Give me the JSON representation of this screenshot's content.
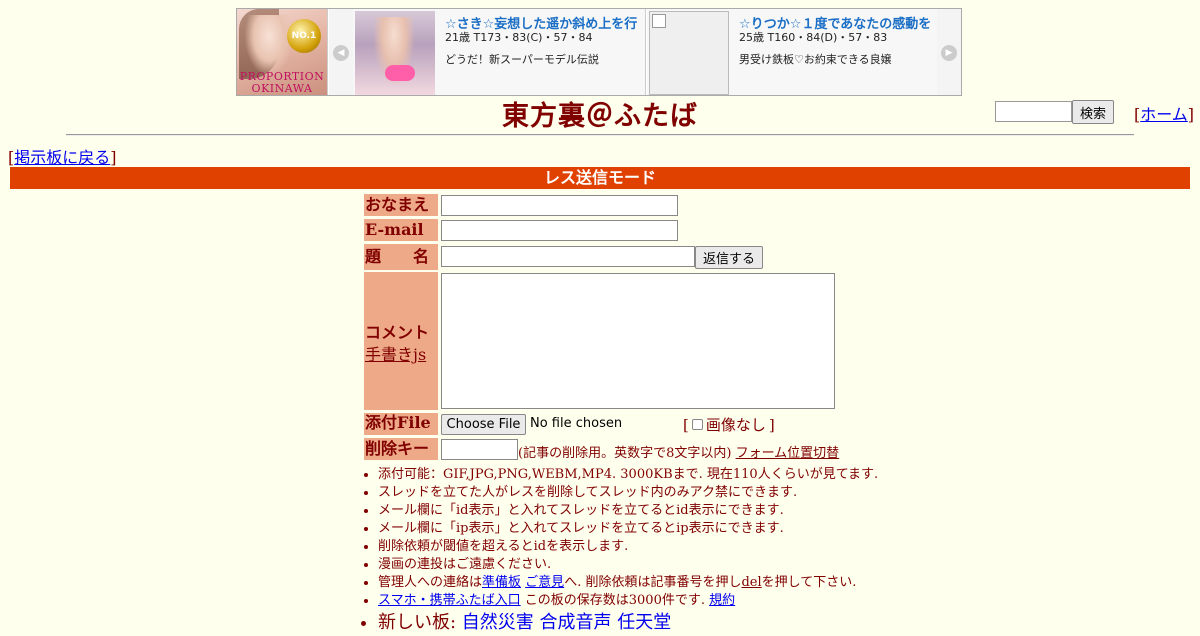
{
  "ad": {
    "logo": {
      "badge": "NO.1",
      "brand_line1": "PROPORTION",
      "brand_line2": "OKINAWA"
    },
    "cards": [
      {
        "title": "☆さき☆妄想した遥か斜め上を行",
        "spec": "21歳 T173・83(C)・57・84",
        "desc": "どうだ！新スーパーモデル伝説"
      },
      {
        "title": "☆りつか☆１度であなたの感動を",
        "spec": "25歳 T160・84(D)・57・83",
        "desc": "男受け鉄板♡お約束できる良嬢"
      }
    ]
  },
  "header": {
    "title": "東方裏＠ふたば",
    "search_button": "検索",
    "home_link": "ホーム"
  },
  "nav": {
    "back_link": "掲示板に戻る"
  },
  "mode_bar": "レス送信モード",
  "form": {
    "labels": {
      "name": "おなまえ",
      "email": "E-mail",
      "subject": "題　　名",
      "comment": "コメント",
      "handwrite": "手書きjs",
      "file": "添付File",
      "delkey": "削除キー"
    },
    "reply_button": "返信する",
    "file_button": "Choose File",
    "file_status": "No file chosen",
    "no_image": "画像なし",
    "delkey_hint": "(記事の削除用。英数字で8文字以内)",
    "form_toggle": "フォーム位置切替"
  },
  "rules": [
    "添付可能：GIF,JPG,PNG,WEBM,MP4. 3000KBまで. 現在110人くらいが見てます.",
    "スレッドを立てた人がレスを削除してスレッド内のみアク禁にできます.",
    "メール欄に「id表示」と入れてスレッドを立てるとid表示にできます.",
    "メール欄に「ip表示」と入れてスレッドを立てるとip表示にできます.",
    "削除依頼が閾値を超えるとidを表示します.",
    "漫画の連投はご遠慮ください."
  ],
  "contact_rule": {
    "prefix": "管理人への連絡は",
    "link1": "準備板",
    "link2": "ご意見",
    "middle": "へ. 削除依頼は記事番号を押し",
    "del": "del",
    "suffix": "を押して下さい."
  },
  "mobile_rule": {
    "link": "スマホ・携帯ふたば入口",
    "text": " この板の保存数は3000件です.",
    "terms": "規約"
  },
  "new_boards": {
    "label": "新しい板: ",
    "boards": [
      "自然災害",
      "合成音声",
      "任天堂"
    ]
  }
}
